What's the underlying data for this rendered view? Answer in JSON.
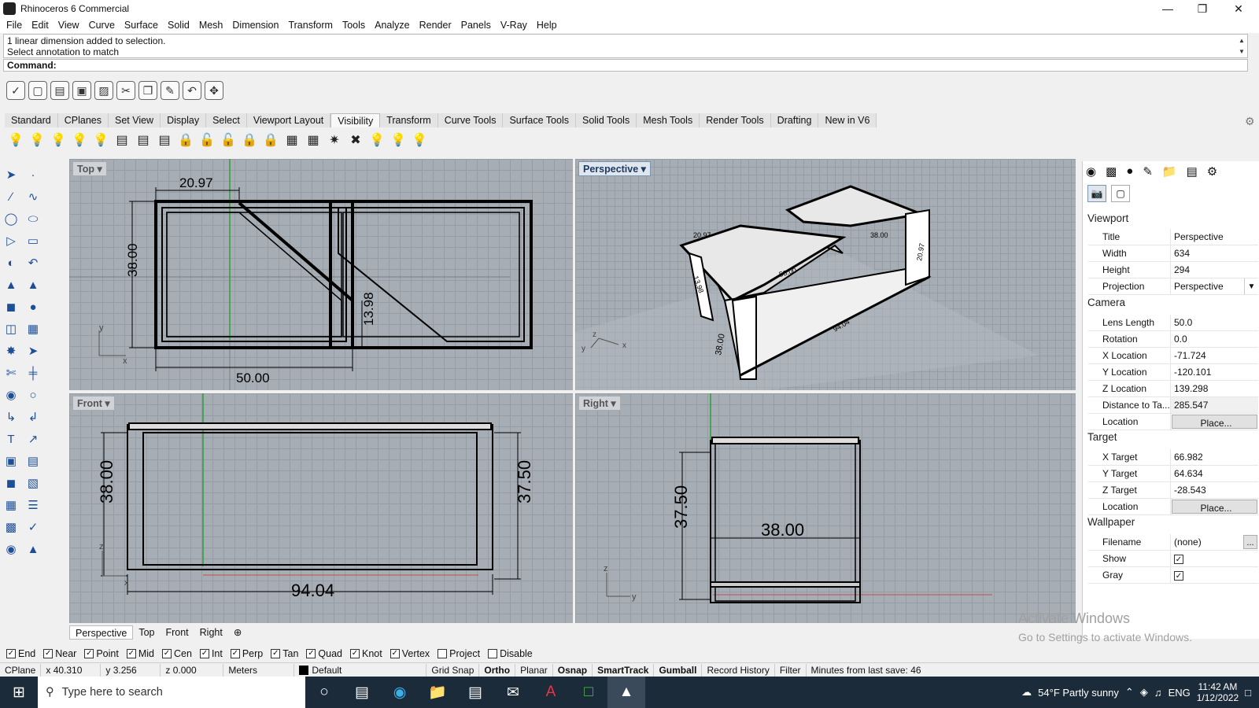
{
  "window": {
    "title": "Rhinoceros 6 Commercial"
  },
  "menu": [
    "File",
    "Edit",
    "View",
    "Curve",
    "Surface",
    "Solid",
    "Mesh",
    "Dimension",
    "Transform",
    "Tools",
    "Analyze",
    "Render",
    "Panels",
    "V-Ray",
    "Help"
  ],
  "command": {
    "history1": "1 linear dimension added to selection.",
    "history2": "Select annotation to match",
    "prompt": "Command:"
  },
  "tabs": [
    "Standard",
    "CPlanes",
    "Set View",
    "Display",
    "Select",
    "Viewport Layout",
    "Visibility",
    "Transform",
    "Curve Tools",
    "Surface Tools",
    "Solid Tools",
    "Mesh Tools",
    "Render Tools",
    "Drafting",
    "New in V6"
  ],
  "active_tab": "Visibility",
  "viewports": {
    "top": {
      "label": "Top",
      "dims": [
        "20.97",
        "38.00",
        "13.98",
        "50.00"
      ]
    },
    "perspective": {
      "label": "Perspective",
      "dims": [
        "20.97",
        "50.00",
        "38.00",
        "94.04",
        "38.00",
        "20.97",
        "13.98"
      ]
    },
    "front": {
      "label": "Front",
      "dims": [
        "38.00",
        "37.50",
        "94.04"
      ]
    },
    "right": {
      "label": "Right",
      "dims": [
        "37.50",
        "38.00"
      ]
    }
  },
  "viewport_tabs": [
    "Perspective",
    "Top",
    "Front",
    "Right"
  ],
  "panel": {
    "viewport_header": "Viewport",
    "title_k": "Title",
    "title_v": "Perspective",
    "width_k": "Width",
    "width_v": "634",
    "height_k": "Height",
    "height_v": "294",
    "projection_k": "Projection",
    "projection_v": "Perspective",
    "camera_header": "Camera",
    "lens_k": "Lens Length",
    "lens_v": "50.0",
    "rotation_k": "Rotation",
    "rotation_v": "0.0",
    "xloc_k": "X Location",
    "xloc_v": "-71.724",
    "yloc_k": "Y Location",
    "yloc_v": "-120.101",
    "zloc_k": "Z Location",
    "zloc_v": "139.298",
    "dist_k": "Distance to Ta...",
    "dist_v": "285.547",
    "location_k": "Location",
    "place": "Place...",
    "target_header": "Target",
    "xt_k": "X Target",
    "xt_v": "66.982",
    "yt_k": "Y Target",
    "yt_v": "64.634",
    "zt_k": "Z Target",
    "zt_v": "-28.543",
    "wallpaper_header": "Wallpaper",
    "filename_k": "Filename",
    "filename_v": "(none)",
    "show_k": "Show",
    "gray_k": "Gray",
    "ellipsis": "..."
  },
  "osnaps": [
    {
      "label": "End",
      "checked": true
    },
    {
      "label": "Near",
      "checked": true
    },
    {
      "label": "Point",
      "checked": true
    },
    {
      "label": "Mid",
      "checked": true
    },
    {
      "label": "Cen",
      "checked": true
    },
    {
      "label": "Int",
      "checked": true
    },
    {
      "label": "Perp",
      "checked": true
    },
    {
      "label": "Tan",
      "checked": true
    },
    {
      "label": "Quad",
      "checked": true
    },
    {
      "label": "Knot",
      "checked": true
    },
    {
      "label": "Vertex",
      "checked": true
    },
    {
      "label": "Project",
      "checked": false
    },
    {
      "label": "Disable",
      "checked": false
    }
  ],
  "status": {
    "cplane": "CPlane",
    "x": "x 40.310",
    "y": "y 3.256",
    "z": "z 0.000",
    "units": "Meters",
    "layer": "Default",
    "items": [
      "Grid Snap",
      "Ortho",
      "Planar",
      "Osnap",
      "SmartTrack",
      "Gumball",
      "Record History",
      "Filter"
    ],
    "minutes": "Minutes from last save: 46"
  },
  "watermark": {
    "line1": "Activate Windows",
    "line2": "Go to Settings to activate Windows."
  },
  "taskbar": {
    "search_placeholder": "Type here to search",
    "weather": "54°F  Partly sunny",
    "lang": "ENG",
    "time": "11:42 AM",
    "date": "1/12/2022"
  },
  "axis_labels": {
    "x": "x",
    "y": "y",
    "z": "z"
  }
}
